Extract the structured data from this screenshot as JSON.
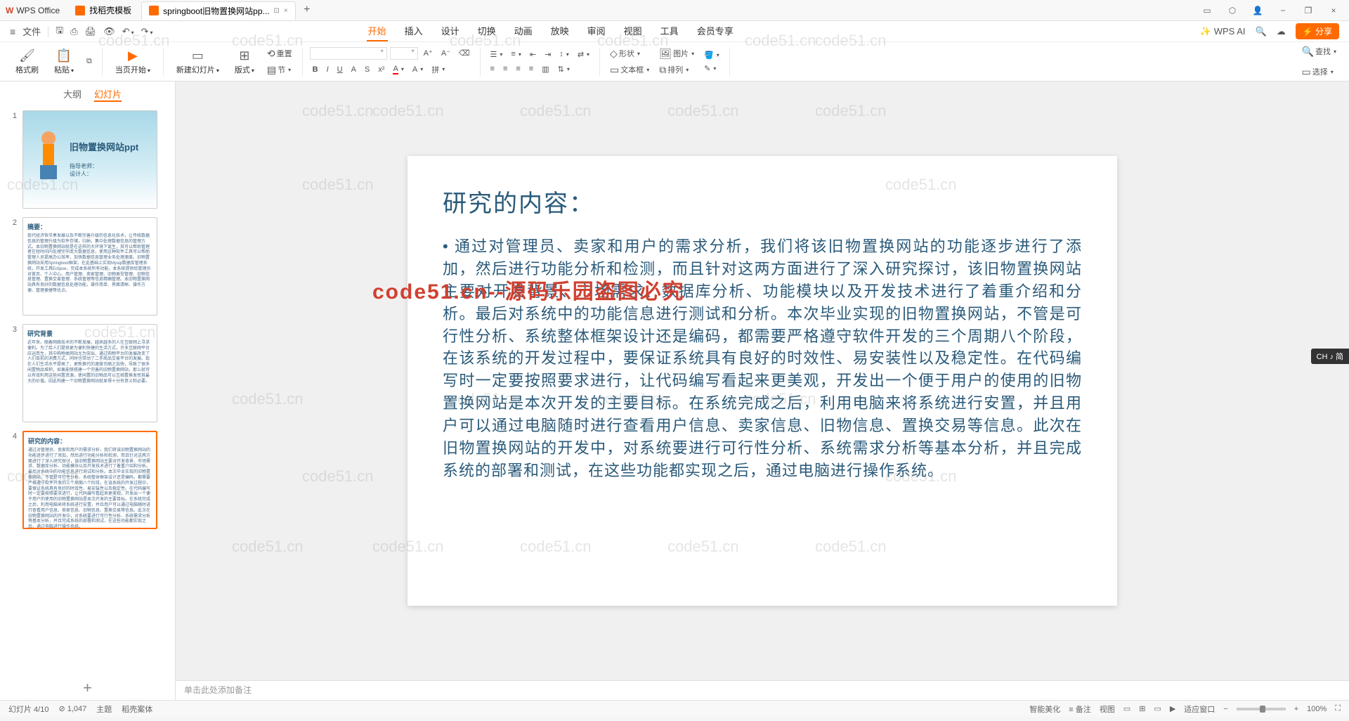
{
  "titlebar": {
    "app": "WPS Office",
    "tabs": [
      {
        "label": "找稻壳模板",
        "icon": "orange"
      },
      {
        "label": "springboot旧物置换网站pp...",
        "icon": "orange",
        "active": true
      }
    ]
  },
  "menubar": {
    "file": "文件",
    "ribbons": [
      "开始",
      "插入",
      "设计",
      "切换",
      "动画",
      "放映",
      "审阅",
      "视图",
      "工具",
      "会员专享"
    ],
    "wpsai": "WPS AI",
    "share": "分享"
  },
  "ribbon": {
    "format_painter": "格式刷",
    "paste": "粘贴",
    "start_page": "当页开始",
    "new_slide": "新建幻灯片",
    "layout": "版式",
    "section": "节",
    "reset": "重置",
    "shape": "形状",
    "image": "图片",
    "textbox": "文本框",
    "arrange": "排列",
    "find": "查找",
    "select": "选择"
  },
  "sidebar": {
    "outline": "大纲",
    "slides": "幻灯片",
    "thumbs": [
      {
        "num": "1",
        "kind": "cover",
        "title": "旧物置换网站ppt",
        "sub1": "指导老师：",
        "sub2": "设计人："
      },
      {
        "num": "2",
        "title": "摘要：",
        "body": "现代经济快节奏发展以及不断完善升级的信息化技术，让传统数据信息的管理升级为软件存储，归纳，集中处理数据信息的管理方式。本旧物置换网站就是在这样的大环境下诞生，其可以帮助管理者在短时间内处理完毕庞大数据信息，使用这种软件工具可以帮助管理人员提高办公效率，加快数据信息管理业务处理速度。旧物置换网站采用Springboot框架，在此基础上实现Mysql数据库管理系统，开发工具Eclipse，完成本系统所有功能。本系统提供给管理员对首页、个人中心、用户管理、卖家管理、旧物类型管理、旧物信息管理、置换交易管理、系统管理等信息精确管理。本旧物置换网站具有良好的数据信息处理功能，操作简单、界面清晰、操作方便、管理便捷等优点。"
      },
      {
        "num": "3",
        "title": "研究背景",
        "body": "近年来，随着网络技术的不断发展，越来越多的人在互联网上寻求便利。为了给人们提供更为便利快捷的生活方式，许多互联网平台应运而生，其中购物类网站尤为突出，通过购物平台的发展改变了人们目前的消费方式，同时也带动了二手商品交易平台的发展。现在人们生活水平提高了，更新换代的速度也随之加快，导致了很多闲置物品堆积，如果能够搭建一个完善的旧物置换网站，那么就可以有效利用这些闲置资源，使闲置的旧物品可以互相置换发挥其最大的价值。因此构建一个旧物置换网站就显得十分有意义和必要。"
      },
      {
        "num": "4",
        "title": "研究的内容：",
        "body": "通过对管理员、卖家和用户的需求分析，我们将该旧物置换网站的功能逐步进行了添加，然后进行功能分析和检测，而且针对这两方面进行了深入研究探讨，该旧物置换网站主要对开发背景、市场需求、数据库分析、功能模块以及开发技术进行了着重介绍和分析。最后对系统中的功能信息进行测试和分析。本次毕业实现的旧物置换网站，不管是可行性分析、系统整体框架设计还是编码，都需要严格遵守软件开发的三个周期八个阶段，在该系统的开发过程中，要保证系统具有良好的时效性、易安装性以及稳定性。在代码编写时一定要按照要求进行，让代码编写看起来更美观，开发出一个便于用户的使用的旧物置换网站是本次开发的主要目标。在系统完成之后，利用电脑来将系统进行安置，并且用户可以通过电脑随时进行查看用户信息、卖家信息、旧物信息、置换交易等信息。此次在旧物置换网站的开发中，对系统要进行可行性分析、系统需求分析等基本分析，并且完成系统的部署和测试，在这些功能都实现之后，通过电脑进行操作系统。",
        "active": true
      }
    ]
  },
  "slide": {
    "title": "研究的内容：",
    "body": "通过对管理员、卖家和用户的需求分析，我们将该旧物置换网站的功能逐步进行了添加，然后进行功能分析和检测，而且针对这两方面进行了深入研究探讨，该旧物置换网站主要对开发背景、市场需求、数据库分析、功能模块以及开发技术进行了着重介绍和分析。最后对系统中的功能信息进行测试和分析。本次毕业实现的旧物置换网站，不管是可行性分析、系统整体框架设计还是编码，都需要严格遵守软件开发的三个周期八个阶段，在该系统的开发过程中，要保证系统具有良好的时效性、易安装性以及稳定性。在代码编写时一定要按照要求进行，让代码编写看起来更美观，开发出一个便于用户的使用的旧物置换网站是本次开发的主要目标。在系统完成之后，利用电脑来将系统进行安置，并且用户可以通过电脑随时进行查看用户信息、卖家信息、旧物信息、置换交易等信息。此次在旧物置换网站的开发中，对系统要进行可行性分析、系统需求分析等基本分析，并且完成系统的部署和测试，在这些功能都实现之后，通过电脑进行操作系统。"
  },
  "notes": {
    "placeholder": "单击此处添加备注"
  },
  "statusbar": {
    "slide_pos": "幻灯片 4/10",
    "wordcount": "⊘ 1,047",
    "theme": "主题",
    "template": "稻壳案体",
    "note": "备注",
    "smart": "智能美化",
    "view": "视图",
    "fit": "适应窗口",
    "zoom": "100%"
  },
  "watermarks": {
    "text": "code51.cn",
    "red": "code51.cn--源码乐园盗图必究"
  },
  "ime": "CH ♪ 简"
}
